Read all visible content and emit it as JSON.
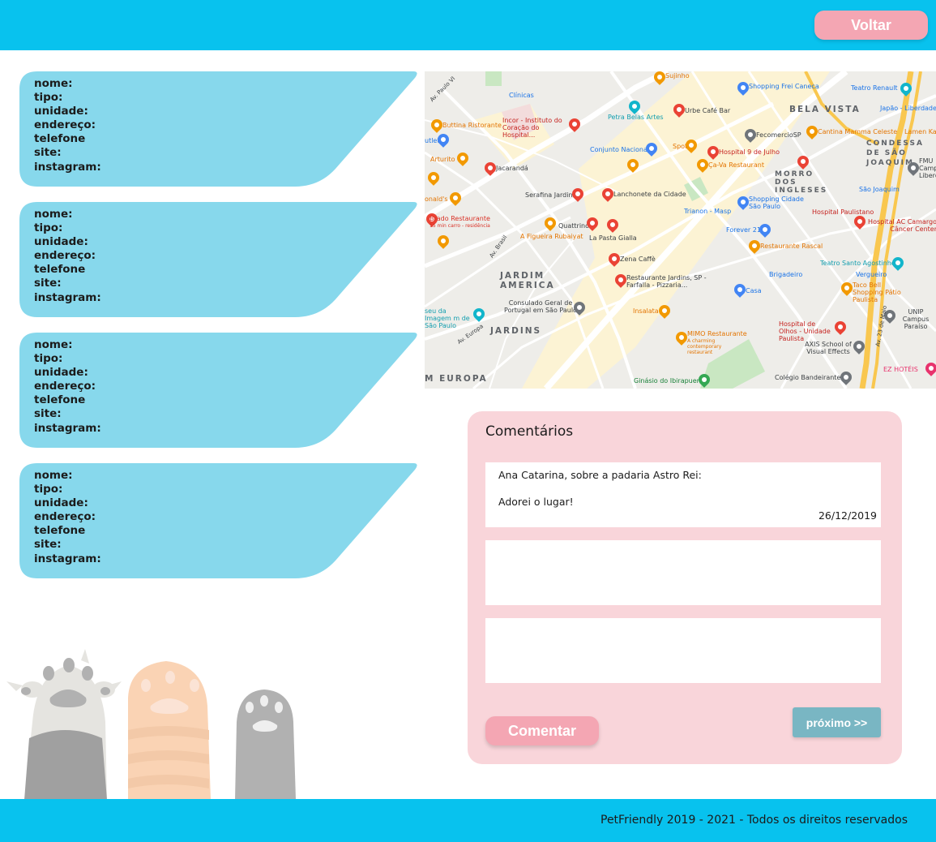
{
  "header": {
    "back_button_label": "Voltar"
  },
  "place_fields": {
    "nome": "nome:",
    "tipo": "tipo:",
    "unidade": "unidade:",
    "endereco": "endereço:",
    "telefone": "telefone",
    "site": "site:",
    "instagram": "instagram:"
  },
  "map": {
    "labels": {
      "sujinho": "Sujinho",
      "shopping_frei_caneca": "Shopping Frei Caneca",
      "teatro_renault": "Teatro Renault",
      "japao_liberdade": "Japão - Liberdade",
      "clinicas": "Clínicas",
      "urbe_cafe_bar": "Urbe Café Bar",
      "bela_vista": "BELA VISTA",
      "petra_belas_artes": "Petra Belas Artes",
      "buttina": "Buttina Ristorante",
      "incor": "Incor - Instituto do Coração do Hospital...",
      "fecomercio": "FecomercioSP",
      "cantina_mamma": "Cantina Mamma Celeste",
      "lamen_kazu": "Lamen Kazu",
      "outlet": "utlet",
      "conjunto_nacional": "Conjunto Nacional",
      "spot": "Spot",
      "hospital_9_julho": "Hospital 9 de Julho",
      "condessa": "CONDESSA DE SÃO JOAQUIM",
      "arturito": "Arturito",
      "jacaranda": "Jacarandá",
      "ca_va": "Ça-Va Restaurant",
      "morro_ingleses": "MORRO DOS INGLESES",
      "fmu": "FMU Camp Liberd",
      "serafina": "Serafina Jardins",
      "lanchonete": "Lanchonete da Cidade",
      "shopping_cidade": "Shopping Cidade São Paulo",
      "sao_joaquim": "São Joaquim",
      "donalds": "onald's",
      "trianon": "Trianon - Masp",
      "hospital_paulistano": "Hospital Paulistano",
      "brado": "Brado Restaurante",
      "brado_sub": "15 min carro - residência",
      "quattrino": "Quattrino",
      "forever21": "Forever 21",
      "hospital_ac": "Hospital AC Camargo Câncer Center",
      "a_figueira": "A Figueira Rubaiyat",
      "la_pasta": "La Pasta Gialla",
      "rascal": "Restaurante Rascal",
      "zena": "Zena Caffè",
      "teatro_santo": "Teatro Santo Agostinho",
      "jardim_america": "JARDIM AMERICA",
      "restaurante_jardins": "Restaurante Jardins, SP - Farfalla - Pizzaria...",
      "brigadeiro": "Brigadeiro",
      "vergueiro": "Vergueiro",
      "casa": "Casa",
      "taco_bell": "Taco Bell Shopping Pátio Paulista",
      "consulado": "Consulado Geral de Portugal em São Paulo",
      "museu": "seu da Imagem m de São Paulo",
      "insalata": "Insalata",
      "unip": "UNIP Campus Paraíso",
      "jardins": "JARDINS",
      "mimo": "MIMO Restaurante",
      "mimo_sub": "A charming contemporary restaurant",
      "hospital_olhos": "Hospital de Olhos - Unidade Paulista",
      "axis": "AXIS School of Visual Effects",
      "ez_hoteis": "EZ HOTÉIS",
      "europa": "M EUROPA",
      "ibirapuera": "Ginásio do Ibirapuera",
      "colegio": "Colégio Bandeirantes",
      "av_brasil": "Av. Brasil",
      "av_23_maio": "Av. 23 de Maio",
      "av_paulo_vi": "Av. Paulo VI",
      "av_europa": "Av. Europa"
    }
  },
  "comments": {
    "title": "Comentários",
    "items": [
      {
        "author": "Ana Catarina, sobre a padaria Astro Rei:",
        "text": "Adorei o lugar!",
        "date": "26/12/2019"
      },
      {
        "author": "",
        "text": "",
        "date": ""
      },
      {
        "author": "",
        "text": "",
        "date": ""
      }
    ],
    "comment_button_label": "Comentar",
    "next_button_label": "próximo >>"
  },
  "footer": {
    "text": "PetFriendly 2019 - 2021 - Todos os direitos reservados"
  },
  "colors": {
    "header_bg": "#08c2ee",
    "card_bg": "#87d8ec",
    "button_pink": "#f4a6b3",
    "comments_bg": "#f9d5da",
    "next_button": "#79b6c3"
  }
}
